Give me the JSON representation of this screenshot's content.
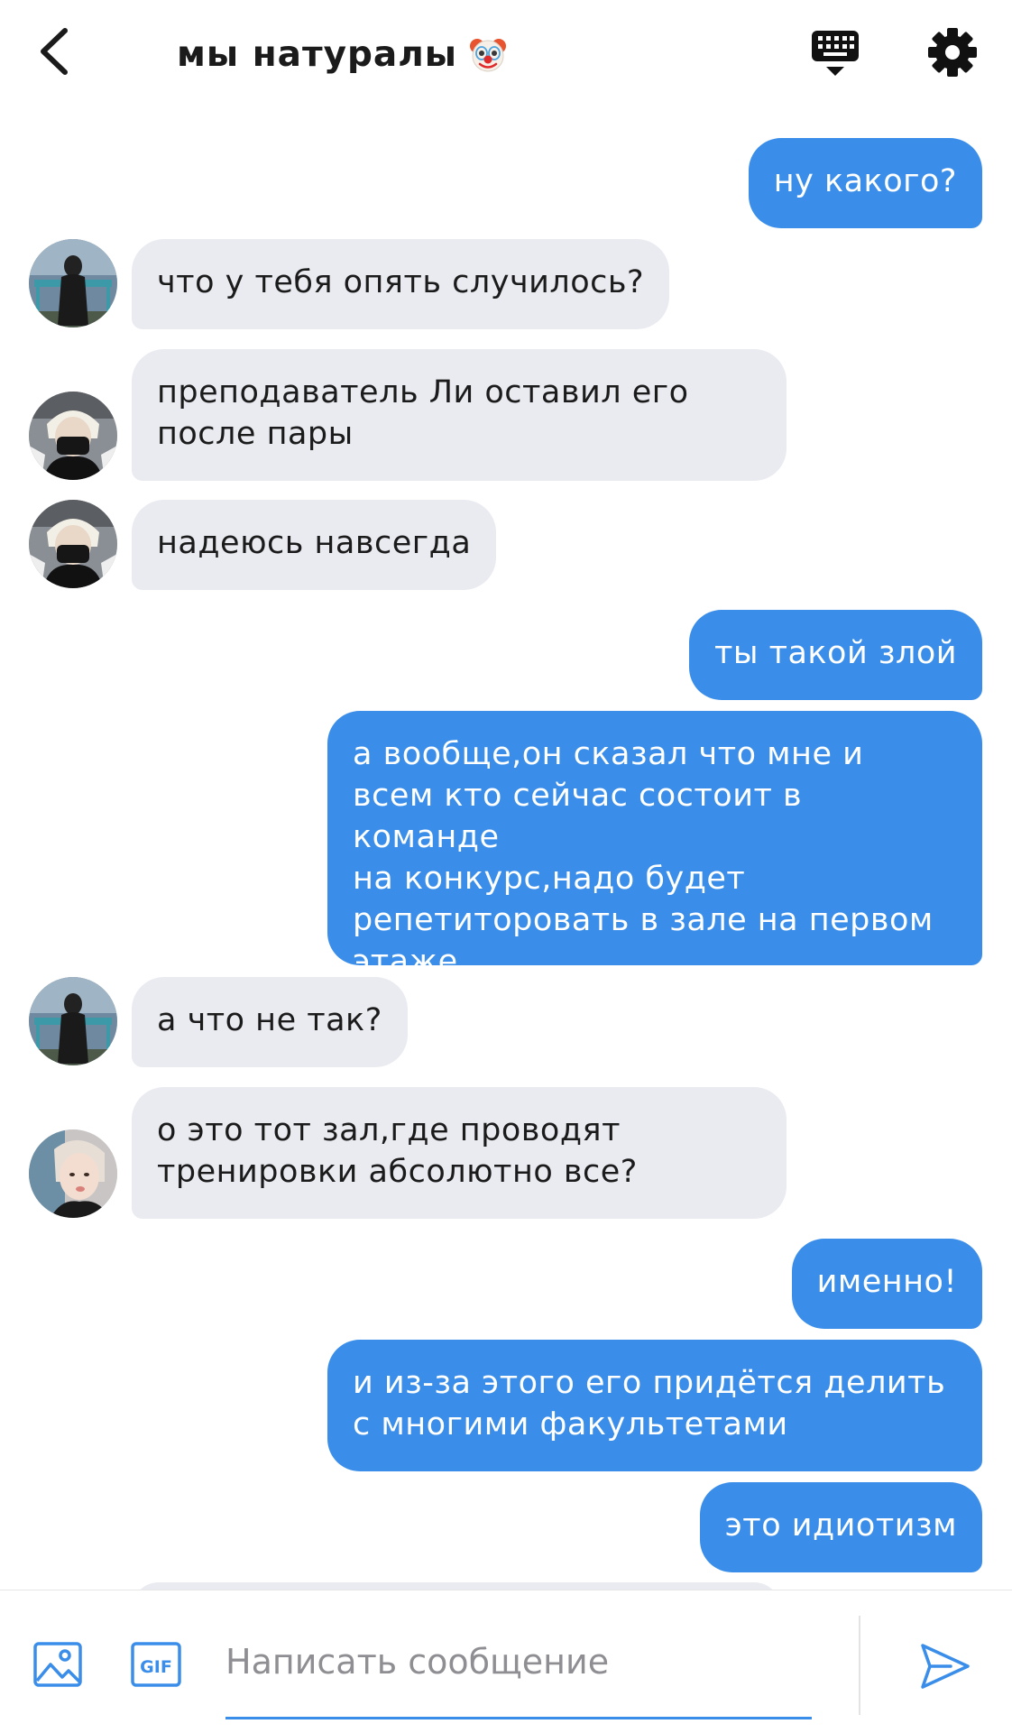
{
  "header": {
    "title": "мы натуралы",
    "back_icon": "chevron-left-icon",
    "keyboard_icon": "keyboard-dismiss-icon",
    "settings_icon": "gear-icon",
    "clown_icon": "clown-face-emoji"
  },
  "messages": [
    {
      "side": "out",
      "text": "ну какого?"
    },
    {
      "side": "in",
      "avatar": "a",
      "text": "что у тебя опять случилось?"
    },
    {
      "side": "in",
      "avatar": "b",
      "text": "преподаватель Ли оставил его\nпосле пары"
    },
    {
      "side": "in",
      "avatar": "b",
      "text": "надеюсь навсегда"
    },
    {
      "side": "out",
      "text": "ты такой злой"
    },
    {
      "side": "out",
      "text": "а вообще,он сказал что мне и\nвсем кто сейчас состоит в команде\nна конкурс,надо будет\nрепетиторовать в зале на первом\nэтаже"
    },
    {
      "side": "in",
      "avatar": "a",
      "text": "а что не так?"
    },
    {
      "side": "in",
      "avatar": "c",
      "text": "о это тот зал,где проводят\nтренировки абсолютно все?"
    },
    {
      "side": "out",
      "text": "именно!"
    },
    {
      "side": "out",
      "text": "и из-за этого его придётся делить\nс многими факультетами"
    },
    {
      "side": "out",
      "text": "это идиотизм"
    }
  ],
  "composer": {
    "placeholder": "Написать сообщение",
    "value": "",
    "gif_label": "GIF",
    "image_icon": "image-icon",
    "send_icon": "send-icon"
  },
  "colors": {
    "outgoing_bubble": "#3a8ee9",
    "incoming_bubble": "#eaebf1",
    "accent": "#3a8ee9",
    "text_dark": "#1b1b1b"
  }
}
